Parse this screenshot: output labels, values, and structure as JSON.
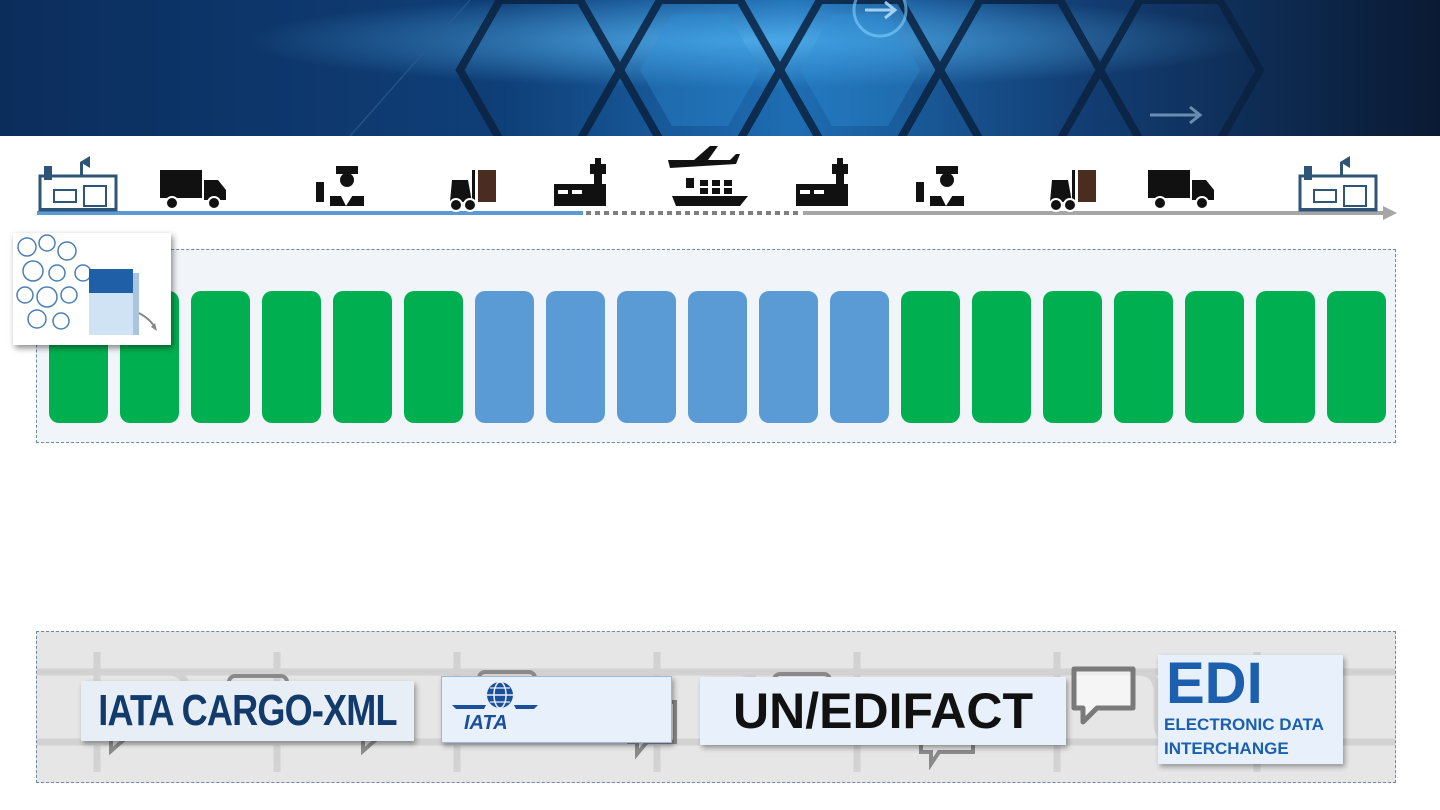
{
  "colors": {
    "banner_dark": "#0a2a55",
    "banner_mid": "#1f6fae",
    "shipper_segment": "#5b9bd5",
    "carrier_segment": "#7f7f7f",
    "transit_segment": "#7f7f7f",
    "block_green": "#00b050",
    "block_blue": "#5b9bd5",
    "icon_dark": "#111111",
    "icon_outline": "#2e5478",
    "icon_brown": "#4a2d1e"
  },
  "timeline_icons": [
    "factory-icon",
    "truck-icon",
    "customs-officer-icon",
    "forklift-icon",
    "airport-icon",
    "airplane-ship-icon",
    "airport-icon",
    "customs-officer-icon",
    "forklift-icon",
    "truck-icon",
    "factory-icon"
  ],
  "message_blocks": [
    "green",
    "green",
    "green",
    "green",
    "green",
    "green",
    "blue",
    "blue",
    "blue",
    "blue",
    "blue",
    "blue",
    "green",
    "green",
    "green",
    "green",
    "green",
    "green",
    "green"
  ],
  "manual_thumbnail": {
    "icon": "e-freight-manual-icon"
  },
  "standards": {
    "cargo_xml": "IATA CARGO-XML",
    "iata": "IATA",
    "edifact": "UN/EDIFACT",
    "edi_title": "EDI",
    "edi_line1": "ELECTRONIC DATA",
    "edi_line2": "INTERCHANGE"
  }
}
